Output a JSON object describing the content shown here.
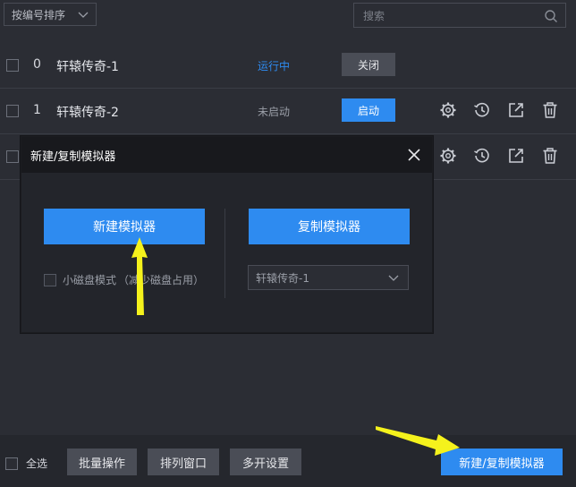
{
  "toolbar": {
    "sort_label": "按编号排序",
    "search_placeholder": "搜索"
  },
  "rows": [
    {
      "index": "0",
      "name": "轩辕传奇-1",
      "status": "运行中",
      "status_color": "#2e8bf0",
      "action": "关闭"
    },
    {
      "index": "1",
      "name": "轩辕传奇-2",
      "status": "未启动",
      "status_color": "#9a9ea7",
      "action": "启动"
    }
  ],
  "modal": {
    "title": "新建/复制模拟器",
    "new_button": "新建模拟器",
    "clone_button": "复制模拟器",
    "small_disk_label": "小磁盘模式",
    "small_disk_hint": "（减少磁盘占用）",
    "clone_source": "轩辕传奇-1"
  },
  "bottom": {
    "select_all": "全选",
    "batch": "批量操作",
    "arrange": "排列窗口",
    "multi_settings": "多开设置",
    "new_clone": "新建/复制模拟器"
  },
  "colors": {
    "accent": "#2e8bf0",
    "annotation_arrow": "#f5f21c"
  }
}
